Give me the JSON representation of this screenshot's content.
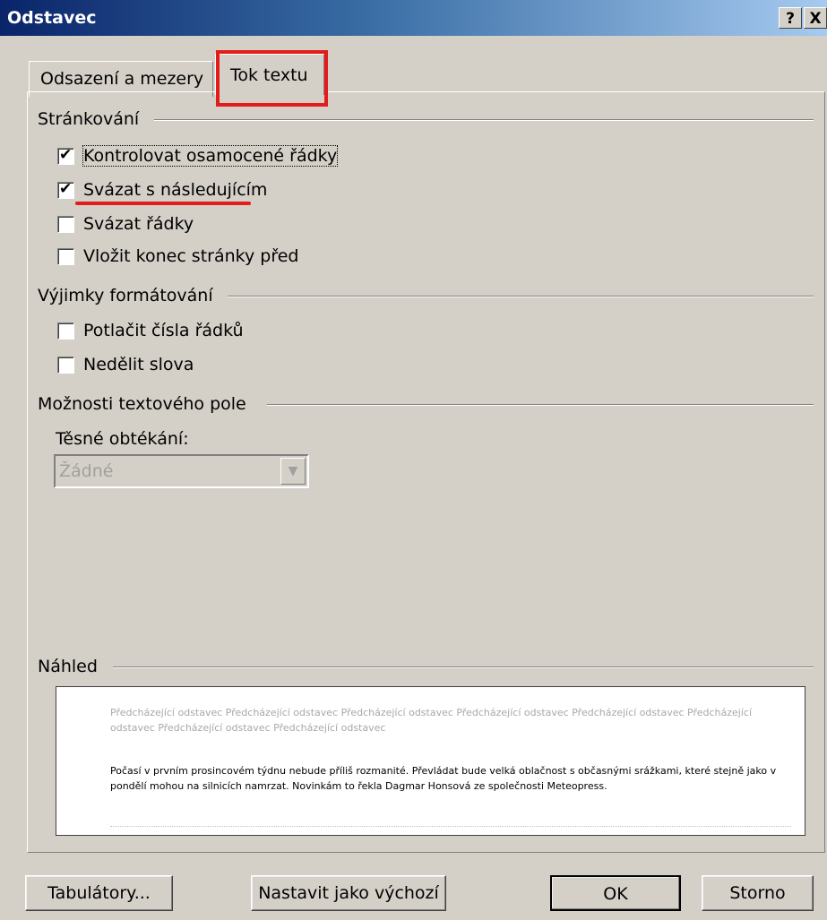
{
  "window": {
    "title": "Odstavec",
    "help_button": "?",
    "close_button": "X"
  },
  "tabs": [
    {
      "label": "Odsazení a mezery",
      "active": false
    },
    {
      "label": "Tok textu",
      "active": true
    }
  ],
  "groups": {
    "pagination": {
      "title": "Stránkování",
      "options": [
        {
          "label": "Kontrolovat osamocené řádky",
          "checked": true
        },
        {
          "label": "Svázat s následujícím",
          "checked": true
        },
        {
          "label": "Svázat řádky",
          "checked": false
        },
        {
          "label": "Vložit konec stránky před",
          "checked": false
        }
      ]
    },
    "formatting_exceptions": {
      "title": "Výjimky formátování",
      "options": [
        {
          "label": "Potlačit čísla řádků",
          "checked": false
        },
        {
          "label": "Nedělit slova",
          "checked": false
        }
      ]
    },
    "textbox_options": {
      "title": "Možnosti textového pole",
      "wrap_label": "Těsné obtékání:",
      "wrap_value": "Žádné"
    },
    "preview": {
      "title": "Náhled",
      "previous_text": "Předcházející odstavec Předcházející odstavec Předcházející odstavec Předcházející odstavec Předcházející odstavec Předcházející odstavec Předcházející odstavec Předcházející odstavec",
      "current_text": "Počasí v prvním prosincovém týdnu nebude příliš rozmanité. Převládat bude velká oblačnost s občasnými srážkami, které stejně jako v pondělí mohou na silnicích namrzat. Novinkám to řekla Dagmar Honsová ze společnosti Meteopress."
    }
  },
  "buttons": {
    "tabs": "Tabulátory...",
    "set_default": "Nastavit jako výchozí",
    "ok": "OK",
    "cancel": "Storno"
  },
  "annotation_color": "#e31b1b"
}
